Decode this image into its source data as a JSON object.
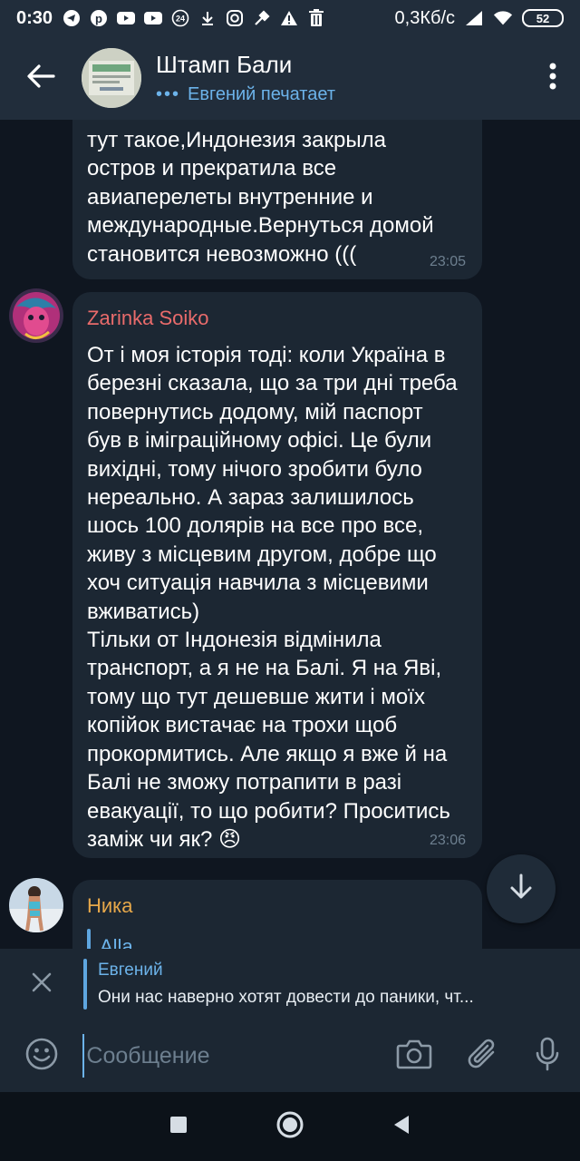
{
  "status_bar": {
    "time": "0:30",
    "net_speed": "0,3Кб/с",
    "battery": "52",
    "icons": [
      "telegram-icon",
      "pinterest-icon",
      "youtube-icon",
      "youtube-icon",
      "24-badge-icon",
      "download-icon",
      "instagram-icon",
      "tool-icon",
      "warning-icon",
      "trash-icon",
      "signal-icon",
      "wifi-icon",
      "battery-icon"
    ]
  },
  "header": {
    "title": "Штамп Бали",
    "typing_status": "Евгений печатает"
  },
  "messages": [
    {
      "sender": "",
      "text": "тут такое,Индонезия закрыла\nостров и прекратила все\nавиаперелеты внутренние и\nмеждународные.Вернуться домой\nстановится невозможно (((",
      "time": "23:05"
    },
    {
      "sender": "Zarinka Soiko",
      "sender_color": "#e96b6b",
      "text": "От і моя історія тоді: коли Україна в\nберезні сказала, що за три дні треба\nповернутись додому, мій паспорт\nбув в іміграційному офісі. Це були\nвихідні, тому нічого зробити було\nнереально. А зараз залишилось\nшось 100 долярів на все про все,\nживу з місцевим другом,  добре що\nхоч ситуація навчила з місцевими\nвживатись)\nТільки от Індонезія відмінила\nтранспорт, а я не на Балі. Я на Яві,\nтому що тут дешевше жити і моїх\nкопійок вистачає на трохи щоб\nпрокормитись. Але якщо я вже й на\nБалі не зможу потрапити в разі\nевакуації, то що робити? Проситись\nзаміж чи як? 😠",
      "time": "23:06"
    },
    {
      "sender": "Ника",
      "sender_color": "#e7a84a",
      "quote_name": "Alla"
    }
  ],
  "reply": {
    "name": "Евгений",
    "text": "Они нас наверно хотят довести до паники, чт..."
  },
  "input": {
    "placeholder": "Сообщение"
  },
  "colors": {
    "accent": "#6cb3ea",
    "background": "#0f1620",
    "bubble": "#1c2733",
    "header": "#212d3b"
  }
}
